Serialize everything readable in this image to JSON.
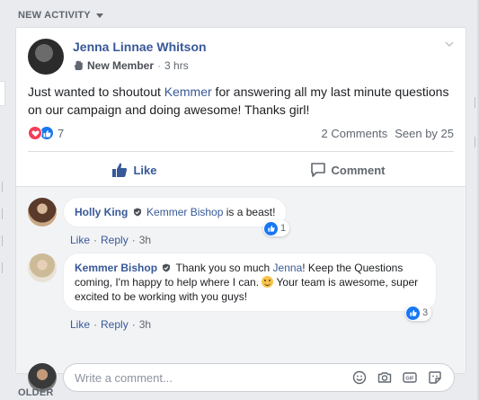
{
  "feed": {
    "section_title": "NEW ACTIVITY",
    "older_label": "OLDER"
  },
  "post": {
    "author": "Jenna Linnae Whitson",
    "badge": "New Member",
    "time": "3 hrs",
    "text_before": "Just wanted to shoutout ",
    "mention": "Kemmer",
    "text_after": " for answering all my last minute questions on our campaign and doing awesome! Thanks girl!",
    "reaction_count": "7",
    "comments_count": "2 Comments",
    "seen_by": "Seen by 25",
    "like_label": "Like",
    "comment_label": "Comment"
  },
  "comments": [
    {
      "author": "Holly King",
      "mention": "Kemmer Bishop",
      "text": " is a beast!",
      "like_label": "Like",
      "reply_label": "Reply",
      "time": "3h",
      "reaction_count": "1"
    },
    {
      "author": "Kemmer Bishop",
      "text_before": " Thank you so much ",
      "mention": "Jenna",
      "text_mid": "! Keep the Questions coming, I'm happy to help where I can. ",
      "text_after": " Your team is awesome, super excited to be working with you guys!",
      "like_label": "Like",
      "reply_label": "Reply",
      "time": "3h",
      "reaction_count": "3"
    }
  ],
  "composer": {
    "placeholder": "Write a comment..."
  },
  "colors": {
    "link_blue": "#385898",
    "like_blue": "#1877f2",
    "love_red": "#f33e58",
    "muted": "#606770"
  },
  "icons": [
    "caret-down-icon",
    "raised-hand-icon",
    "chevron-down-icon",
    "love-reaction-icon",
    "like-reaction-icon",
    "thumbs-up-icon",
    "comment-bubble-icon",
    "verified-shield-icon",
    "smiley-emoji-icon",
    "emoji-icon",
    "camera-icon",
    "gif-icon",
    "sticker-icon"
  ]
}
